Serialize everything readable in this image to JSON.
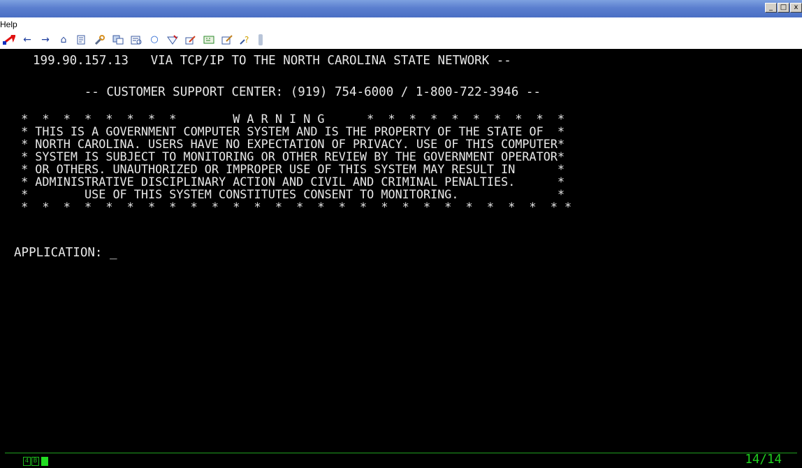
{
  "window": {
    "buttons": [
      "_",
      "□",
      "x"
    ]
  },
  "menu": {
    "items": [
      "Help"
    ]
  },
  "toolbar": {
    "icons": [
      "connect-icon",
      "back-arrow-icon",
      "forward-arrow-icon",
      "home-icon",
      "print-icon",
      "tools-icon",
      "copy-icon",
      "paste-icon",
      "record-icon",
      "macro-icon",
      "edit-icon",
      "keymap-icon",
      "color-icon",
      "help-icon"
    ]
  },
  "terminal": {
    "lines": [
      "199.90.157.13   VIA TCP/IP TO THE NORTH CAROLINA STATE NETWORK --",
      "       -- CUSTOMER SUPPORT CENTER: (919) 754-6000 / 1-800-722-3946 --",
      " *  *  *  *  *  *  *  *        W A R N I N G      *  *  *  *  *  *  *  *  *  *",
      " * THIS IS A GOVERNMENT COMPUTER SYSTEM AND IS THE PROPERTY OF THE STATE OF  *",
      " * NORTH CAROLINA. USERS HAVE NO EXPECTATION OF PRIVACY. USE OF THIS COMPUTER*",
      " * SYSTEM IS SUBJECT TO MONITORING OR OTHER REVIEW BY THE GOVERNMENT OPERATOR*",
      " * OR OTHERS. UNAUTHORIZED OR IMPROPER USE OF THIS SYSTEM MAY RESULT IN      *",
      " * ADMINISTRATIVE DISCIPLINARY ACTION AND CIVIL AND CRIMINAL PENALTIES.      *",
      " *        USE OF THIS SYSTEM CONSTITUTES CONSENT TO MONITORING.              *",
      " *  *  *  *  *  *  *  *  *  *  *  *  *  *  *  *  *  *  *  *  *  *  *  *  *  * *",
      "APPLICATION: _"
    ]
  },
  "status": {
    "oia": [
      "4",
      "B"
    ],
    "cursor": "14/14"
  }
}
